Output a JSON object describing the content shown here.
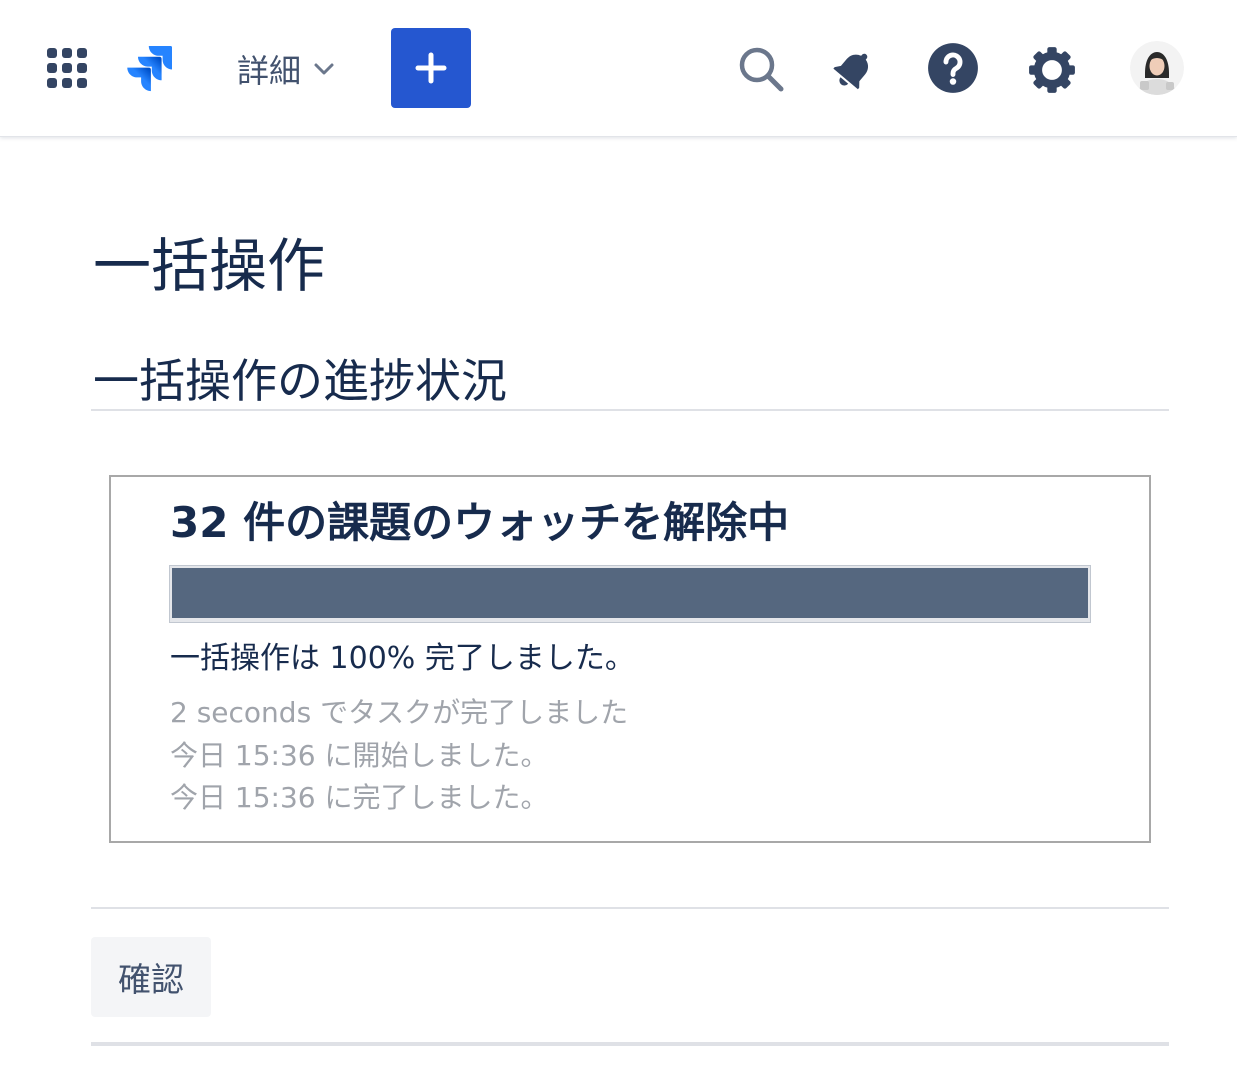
{
  "header": {
    "app_switcher": {
      "icon": "app-grid-icon"
    },
    "logo": {
      "icon": "jira-software-logo-icon"
    },
    "more_menu": {
      "label": "詳細",
      "icon": "chevron-down-icon"
    },
    "create_button": {
      "icon": "plus-icon"
    },
    "search": {
      "icon": "search-icon"
    },
    "notifications": {
      "icon": "bell-icon"
    },
    "help": {
      "icon": "question-circle-icon"
    },
    "settings": {
      "icon": "gear-icon"
    },
    "profile": {
      "icon": "avatar"
    }
  },
  "page": {
    "title": "一括操作",
    "section_title": "一括操作の進捗状況"
  },
  "progress_panel": {
    "heading": "32 件の課題のウォッチを解除中",
    "progress_percent": 100,
    "status_text": "一括操作は 100% 完了しました。",
    "details": [
      "2 seconds でタスクが完了しました",
      "今日 15:36 に開始しました。",
      "今日 15:36 に完了しました。"
    ]
  },
  "actions": {
    "confirm_label": "確認"
  },
  "colors": {
    "brand_blue": "#2557D0",
    "text_primary": "#172B4D",
    "icon_dark": "#344563",
    "progress_fill": "#55677F",
    "muted_text": "#A0A4AB",
    "divider": "#DFE1E6",
    "button_bg": "#F4F5F7"
  }
}
